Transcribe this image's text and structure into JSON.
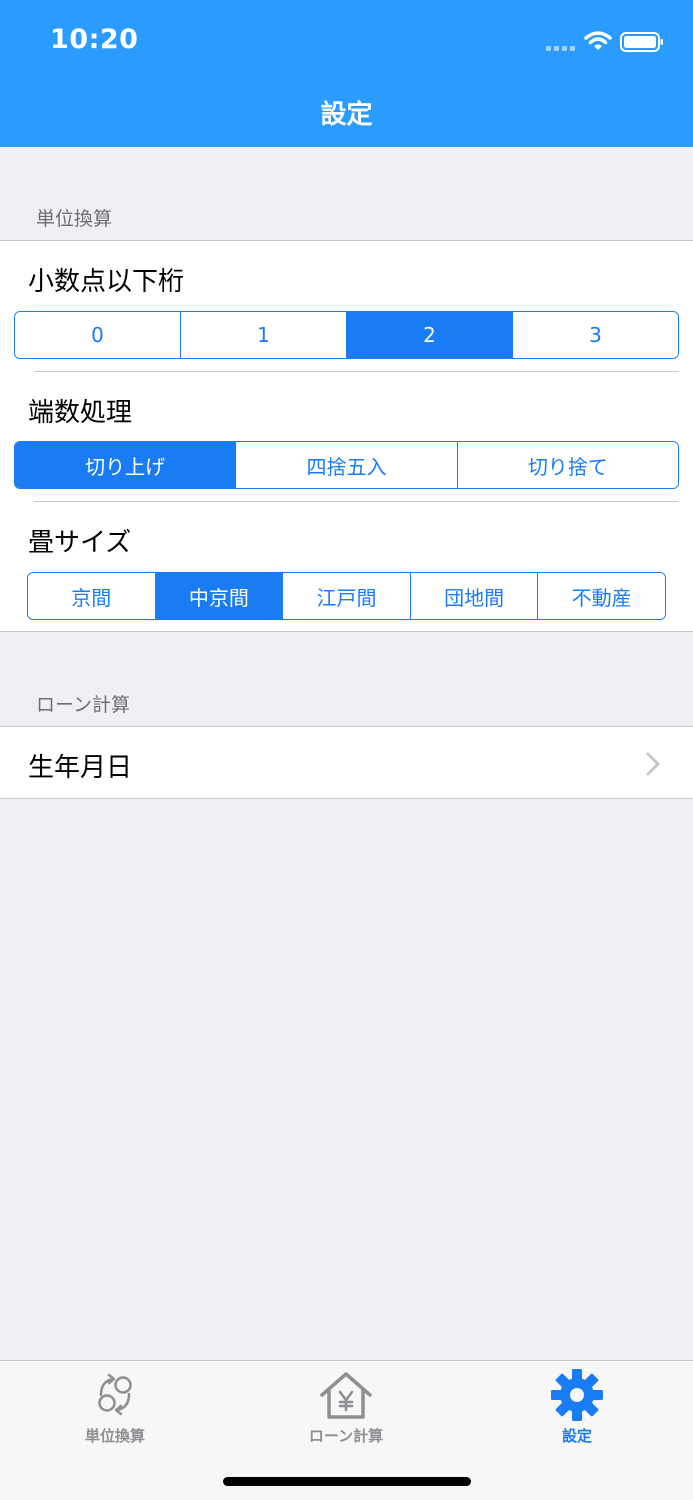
{
  "status_bar": {
    "time": "10:20"
  },
  "nav": {
    "title": "設定"
  },
  "unit_section": {
    "header": "単位換算",
    "decimal": {
      "label": "小数点以下桁",
      "options": [
        "0",
        "1",
        "2",
        "3"
      ],
      "selected": "2"
    },
    "rounding": {
      "label": "端数処理",
      "options": [
        "切り上げ",
        "四捨五入",
        "切り捨て"
      ],
      "selected": "切り上げ"
    },
    "tatami": {
      "label": "畳サイズ",
      "options": [
        "京間",
        "中京間",
        "江戸間",
        "団地間",
        "不動産"
      ],
      "selected": "中京間"
    }
  },
  "loan_section": {
    "header": "ローン計算",
    "birthday_label": "生年月日"
  },
  "tabbar": {
    "tabs": [
      {
        "label": "単位換算",
        "icon": "unit-conversion-icon"
      },
      {
        "label": "ローン計算",
        "icon": "house-yen-icon"
      },
      {
        "label": "設定",
        "icon": "gear-icon"
      }
    ],
    "active": "設定"
  },
  "colors": {
    "nav_background": "#2a9bff",
    "accent": "#1a7cf5",
    "background": "#efeff4",
    "inactive_tab": "#8e8e93"
  }
}
